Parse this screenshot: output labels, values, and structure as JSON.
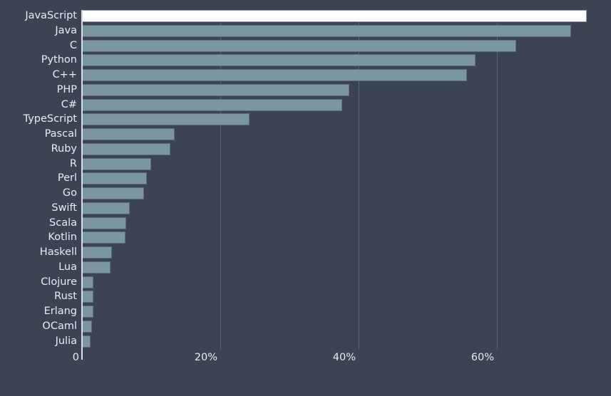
{
  "chart_data": {
    "type": "bar",
    "orientation": "horizontal",
    "title": "",
    "subtitle": "",
    "xlabel": "",
    "ylabel": "",
    "categories": [
      "JavaScript",
      "Java",
      "C",
      "Python",
      "C++",
      "PHP",
      "C#",
      "TypeScript",
      "Pascal",
      "Ruby",
      "R",
      "Perl",
      "Go",
      "Swift",
      "Scala",
      "Kotlin",
      "Haskell",
      "Lua",
      "Clojure",
      "Rust",
      "Erlang",
      "OCaml",
      "Julia"
    ],
    "values": [
      73.0,
      70.7,
      62.8,
      56.9,
      55.7,
      38.7,
      37.6,
      24.2,
      13.4,
      12.8,
      10.0,
      9.4,
      9.0,
      6.9,
      6.4,
      6.3,
      4.3,
      4.1,
      1.6,
      1.6,
      1.6,
      1.4,
      1.2
    ],
    "highlighted_index": 0,
    "xlim": [
      0,
      76.5
    ],
    "ylim": [
      0,
      23
    ],
    "xticks": [
      0,
      20,
      40,
      60
    ],
    "xtick_labels": [
      "0",
      "20%",
      "40%",
      "60%"
    ],
    "grid": true,
    "grid_axis": "x",
    "legend": false,
    "legend_position": "none",
    "colors": {
      "background": "#3c4453",
      "bar_fill": "#7a97a0",
      "bar_edge": "#5d6b78",
      "bar_highlight_fill": "#ffffff",
      "gridline": "#5b6372",
      "axis_line": "#d8dde4",
      "text": "#e9edf2"
    }
  }
}
